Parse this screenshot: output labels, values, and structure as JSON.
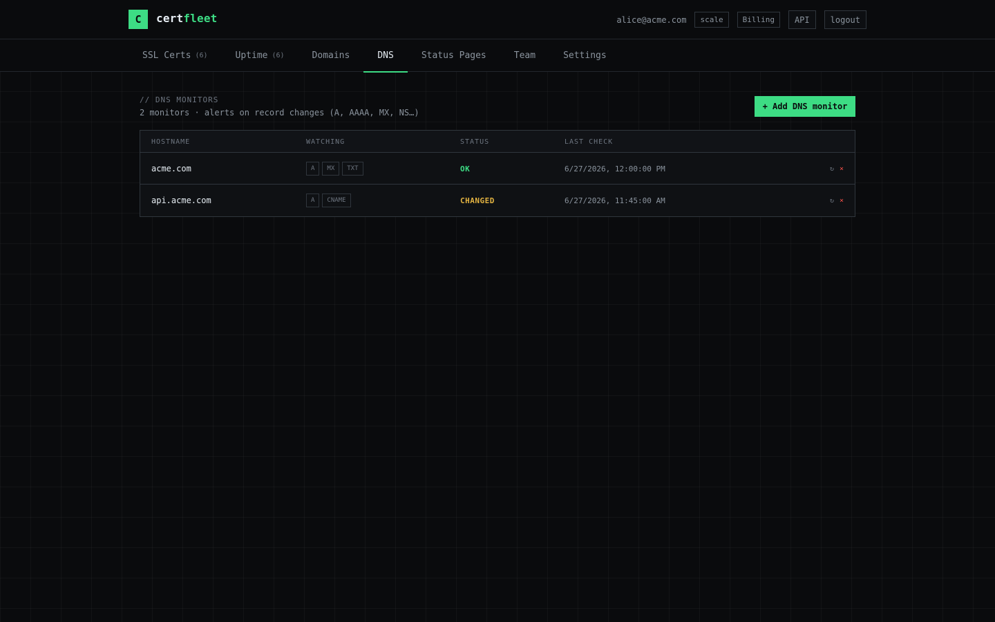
{
  "header": {
    "logo_letter": "C",
    "brand_part1": "cert",
    "brand_part2": "fleet",
    "user_email": "alice@acme.com",
    "plan": "scale",
    "billing_label": "Billing",
    "api_label": "API",
    "logout_label": "logout"
  },
  "tabs": [
    {
      "label": "SSL Certs",
      "count": "(6)"
    },
    {
      "label": "Uptime",
      "count": "(6)"
    },
    {
      "label": "Domains",
      "count": ""
    },
    {
      "label": "DNS",
      "count": "",
      "active": true
    },
    {
      "label": "Status Pages",
      "count": ""
    },
    {
      "label": "Team",
      "count": ""
    },
    {
      "label": "Settings",
      "count": ""
    }
  ],
  "section": {
    "title": "// DNS MONITORS",
    "subtitle": "2 monitors · alerts on record changes (A, AAAA, MX, NS…)",
    "add_button": "+ Add DNS monitor"
  },
  "table": {
    "columns": [
      "HOSTNAME",
      "WATCHING",
      "STATUS",
      "LAST CHECK"
    ],
    "rows": [
      {
        "hostname": "acme.com",
        "watching": [
          "A",
          "MX",
          "TXT"
        ],
        "status": "OK",
        "last_check": "6/27/2026, 12:00:00 PM"
      },
      {
        "hostname": "api.acme.com",
        "watching": [
          "A",
          "CNAME"
        ],
        "status": "CHANGED",
        "last_check": "6/27/2026, 11:45:00 AM"
      }
    ],
    "refresh_icon": "↻",
    "delete_icon": "×"
  },
  "colors": {
    "accent": "#3ddc84",
    "warning": "#e3b341",
    "danger": "#f85149",
    "background": "#0a0b0d"
  }
}
